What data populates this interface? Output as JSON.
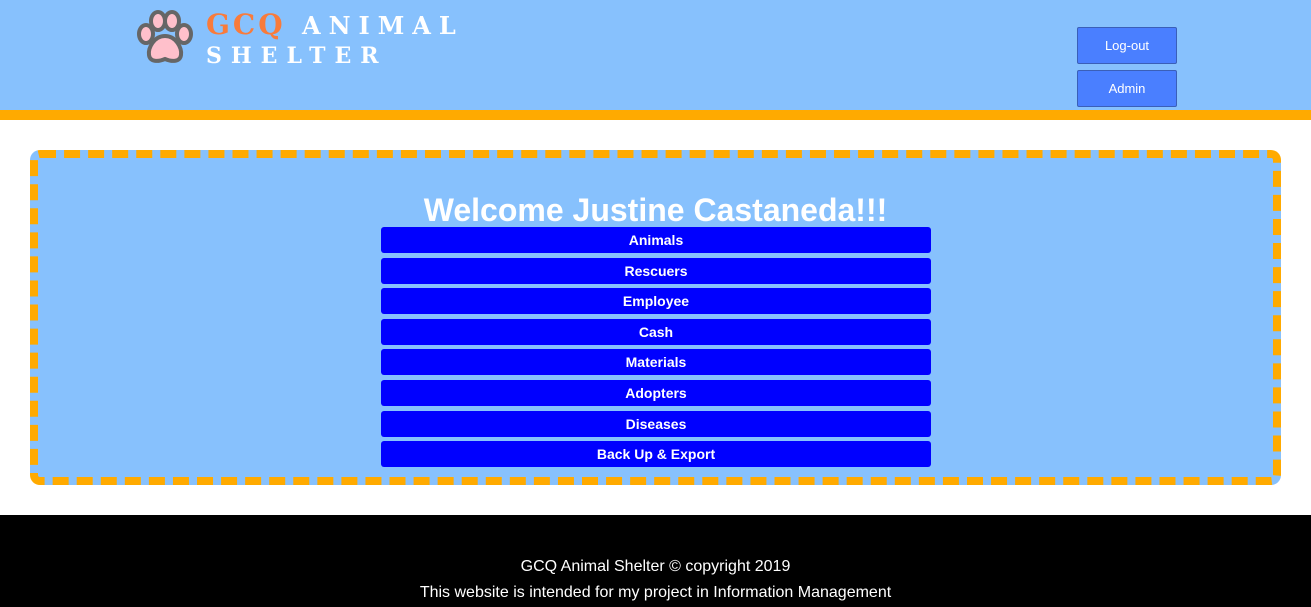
{
  "header": {
    "brand_short": "GCQ",
    "brand_rest": "ANIMAL",
    "brand_line2": "SHELTER",
    "logout_label": "Log-out",
    "admin_label": "Admin",
    "paw_icon": "paw-icon"
  },
  "colors": {
    "header_bg": "#87c1fd",
    "accent_orange": "#ffaa00",
    "menu_button": "#0000ff",
    "header_button": "#4a7fff",
    "logo_orange": "#f97b3b"
  },
  "main": {
    "welcome": "Welcome Justine Castaneda!!!",
    "menu": [
      {
        "label": "Animals"
      },
      {
        "label": "Rescuers"
      },
      {
        "label": "Employee"
      },
      {
        "label": "Cash"
      },
      {
        "label": "Materials"
      },
      {
        "label": "Adopters"
      },
      {
        "label": "Diseases"
      },
      {
        "label": "Back Up & Export"
      }
    ]
  },
  "footer": {
    "copyright": "GCQ Animal Shelter © copyright 2019",
    "note": "This website is intended for my project in Information Management"
  }
}
